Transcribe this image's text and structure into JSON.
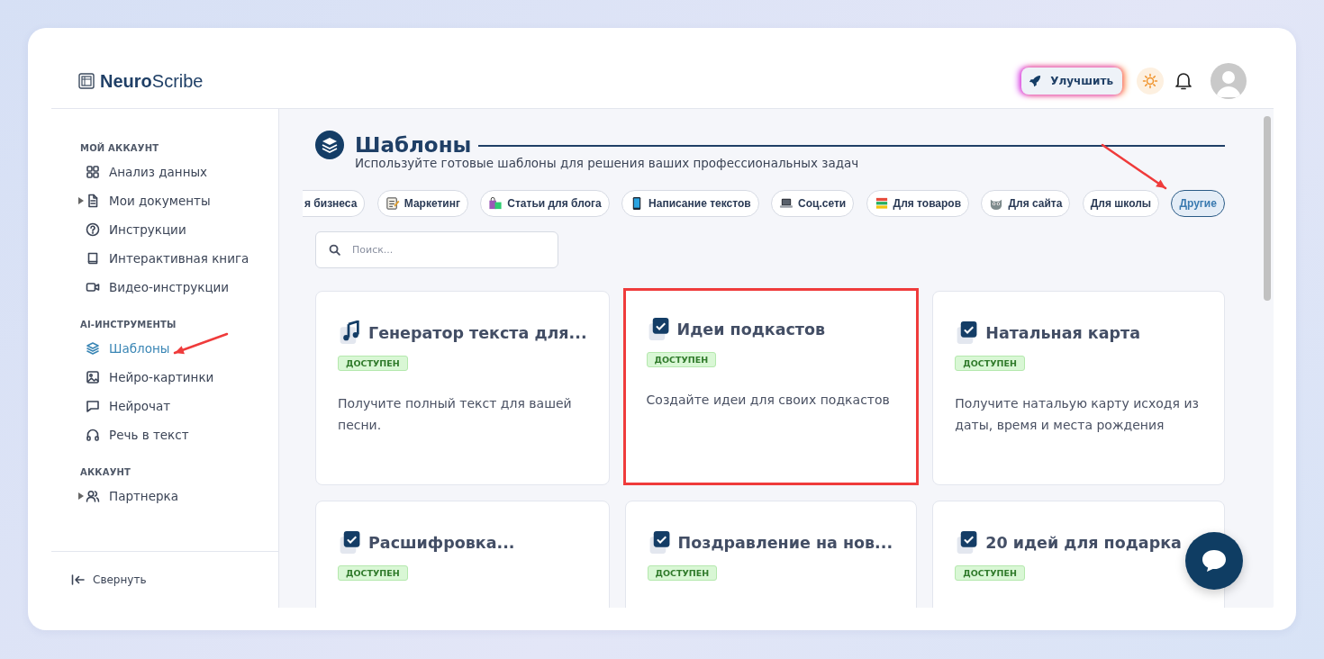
{
  "logo": {
    "bold": "Neuro",
    "light": "Scribe"
  },
  "header": {
    "upgrade_button": "Улучшить"
  },
  "sidebar": {
    "sections": [
      {
        "title": "МОЙ АККАУНТ",
        "items": [
          {
            "label": "Анализ данных",
            "kind": "grid",
            "has_children": false,
            "selected": false,
            "annotated": false
          },
          {
            "label": "Мои документы",
            "kind": "document",
            "has_children": true,
            "selected": false,
            "annotated": false
          },
          {
            "label": "Инструкции",
            "kind": "question",
            "has_children": false,
            "selected": false,
            "annotated": false
          },
          {
            "label": "Интерактивная книга",
            "kind": "book",
            "has_children": false,
            "selected": false,
            "annotated": false
          },
          {
            "label": "Видео-инструкции",
            "kind": "video",
            "has_children": false,
            "selected": false,
            "annotated": false
          }
        ]
      },
      {
        "title": "AI-ИНСТРУМЕНТЫ",
        "items": [
          {
            "label": "Шаблоны",
            "kind": "layers",
            "has_children": false,
            "selected": true,
            "annotated": true
          },
          {
            "label": "Нейро-картинки",
            "kind": "image",
            "has_children": false,
            "selected": false,
            "annotated": false
          },
          {
            "label": "Нейрочат",
            "kind": "chat",
            "has_children": false,
            "selected": false,
            "annotated": false
          },
          {
            "label": "Речь в текст",
            "kind": "headphones",
            "has_children": false,
            "selected": false,
            "annotated": false
          }
        ]
      },
      {
        "title": "АККАУНТ",
        "items": [
          {
            "label": "Партнерка",
            "kind": "users",
            "has_children": true,
            "selected": false,
            "annotated": false
          }
        ]
      }
    ],
    "collapse": "Свернуть"
  },
  "main": {
    "title": "Шаблоны",
    "subtitle": "Используйте готовые шаблоны для решения ваших профессиональных задач",
    "tabs": [
      {
        "label": "я бизнеса",
        "kind": "none",
        "clipped": true,
        "selected": false,
        "annotated": false
      },
      {
        "label": "Маркетинг",
        "kind": "notepad",
        "clipped": false,
        "selected": false,
        "annotated": false
      },
      {
        "label": "Статьи для блога",
        "kind": "bags",
        "clipped": false,
        "selected": false,
        "annotated": false
      },
      {
        "label": "Написание текстов",
        "kind": "phone",
        "clipped": false,
        "selected": false,
        "annotated": false
      },
      {
        "label": "Соц.сети",
        "kind": "laptop",
        "clipped": false,
        "selected": false,
        "annotated": false
      },
      {
        "label": "Для товаров",
        "kind": "books",
        "clipped": false,
        "selected": false,
        "annotated": false
      },
      {
        "label": "Для сайта",
        "kind": "face",
        "clipped": false,
        "selected": false,
        "annotated": false
      },
      {
        "label": "Для школы",
        "kind": "none",
        "clipped": false,
        "selected": false,
        "annotated": false
      },
      {
        "label": "Другие",
        "kind": "none",
        "clipped": false,
        "selected": true,
        "annotated": true
      }
    ],
    "search": {
      "placeholder": "Поиск..."
    },
    "cards": [
      {
        "title": "Генератор текста для...",
        "kind": "music",
        "badge": "ДОСТУПЕН",
        "description": "Получите полный текст для вашей песни.",
        "highlighted": false
      },
      {
        "title": "Идеи подкастов",
        "kind": "check",
        "badge": "ДОСТУПЕН",
        "description": "Создайте идеи для своих подкастов",
        "highlighted": true
      },
      {
        "title": "Натальная карта",
        "kind": "check",
        "badge": "ДОСТУПЕН",
        "description": "Получите натальую карту исходя из даты, время и места рождения",
        "highlighted": false
      },
      {
        "title": "Расшифровка...",
        "kind": "check",
        "badge": "ДОСТУПЕН",
        "highlighted": false
      },
      {
        "title": "Поздравление на нов...",
        "kind": "check",
        "badge": "ДОСТУПЕН",
        "highlighted": false
      },
      {
        "title": "20 идей для подарка",
        "kind": "check",
        "badge": "ДОСТУПЕН",
        "highlighted": false
      }
    ]
  }
}
